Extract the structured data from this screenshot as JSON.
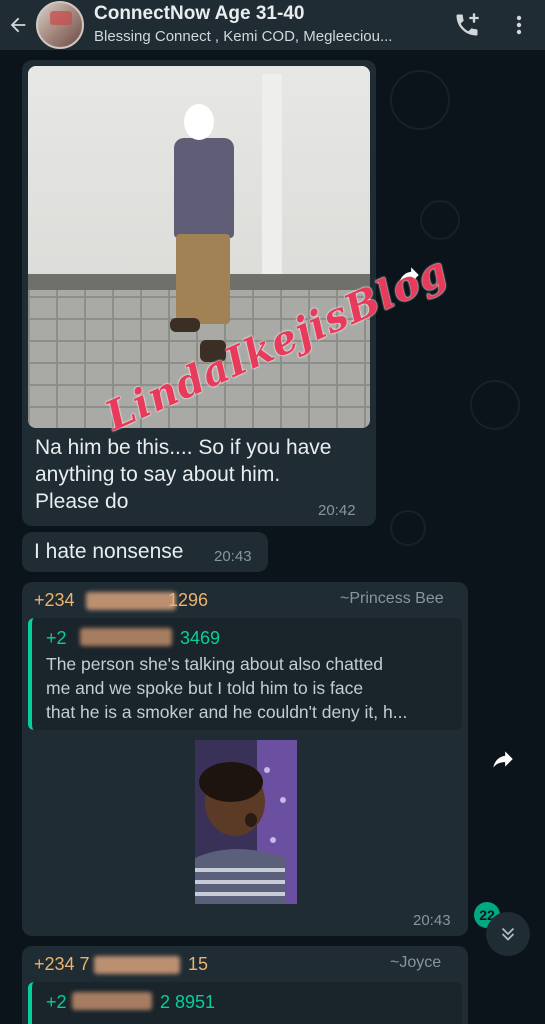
{
  "header": {
    "title": "ConnectNow Age 31-40",
    "subtitle": "Blessing Connect , Kemi COD, Megleeciou...",
    "back_icon": "arrow-left-icon",
    "call_icon": "add-call-icon",
    "menu_icon": "more-vert-icon"
  },
  "messages": [
    {
      "type": "image",
      "caption_lines": [
        "Na him be this.... So if you have",
        "anything to say about him.",
        "Please do"
      ],
      "time": "20:42"
    },
    {
      "type": "text",
      "text": "I hate nonsense",
      "time": "20:43"
    },
    {
      "type": "reply",
      "sender_prefix": "+234",
      "sender_suffix": "1296",
      "sender_name": "~Princess Bee",
      "quoted_prefix": "+2",
      "quoted_suffix": "3469",
      "quoted_lines": [
        "The person she's talking about also chatted",
        "me and we spoke but I told him to is face",
        "that he is a smoker and he couldn't deny it, h..."
      ],
      "time": "20:43"
    },
    {
      "type": "reply",
      "sender_prefix": "+234 7",
      "sender_suffix": "15",
      "sender_name": "~Joyce",
      "quoted_prefix": "+2",
      "quoted_suffix": "2 8951"
    }
  ],
  "watermark": "LindaIkejisBlog",
  "unread_badge": "22",
  "colors": {
    "header_bg": "#1f2c34",
    "chat_bg": "#0b141a",
    "bubble_bg": "#1f2c34",
    "accent": "#00a884",
    "sender_color": "#ecb36d",
    "quote_bar": "#06cf9c"
  }
}
